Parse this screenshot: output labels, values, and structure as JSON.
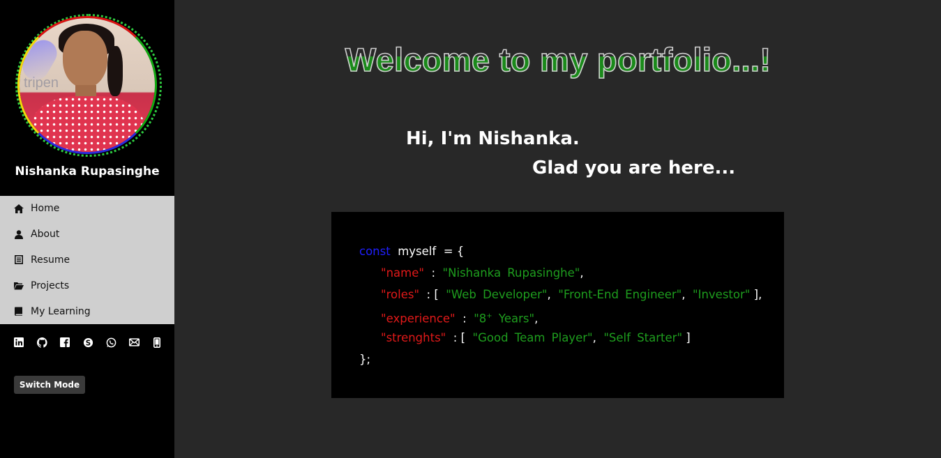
{
  "sidebar": {
    "name": "Nishanka Rupasinghe",
    "avatar_bg_text": "tripen",
    "nav": [
      {
        "label": "Home",
        "icon": "home-icon"
      },
      {
        "label": "About",
        "icon": "user-icon"
      },
      {
        "label": "Resume",
        "icon": "document-icon"
      },
      {
        "label": "Projects",
        "icon": "folder-icon"
      },
      {
        "label": "My Learning",
        "icon": "book-icon"
      }
    ],
    "social": [
      "linkedin-icon",
      "github-icon",
      "facebook-icon",
      "skype-icon",
      "whatsapp-icon",
      "mail-icon",
      "phone-icon"
    ],
    "switch_mode": "Switch Mode"
  },
  "main": {
    "welcome": "Welcome to my portfolio...!",
    "greeting_line1": "Hi, I'm Nishanka.",
    "greeting_line2": "Glad you are here...",
    "code": {
      "const_kw": "const",
      "var_name": "myself",
      "assign": "= {",
      "name_key": "\"name\"",
      "name_val": "\"Nishanka  Rupasinghe\"",
      "roles_key": "\"roles\"",
      "roles_vals": [
        "\"Web  Developer\"",
        "\"Front-End  Engineer\"",
        "\"Investor\""
      ],
      "experience_key": "\"experience\"",
      "experience_val_a": "\"8",
      "experience_val_sup": "+",
      "experience_val_b": "  Years\"",
      "strengths_key": "\"strenghts\"",
      "strengths_vals": [
        "\"Good  Team  Player\"",
        "\"Self  Starter\""
      ],
      "close": "};"
    }
  },
  "colors": {
    "sidebar_bg": "#000000",
    "nav_bg": "#cfcfcf",
    "page_bg": "#282828",
    "code_keyword": "#1f1fff",
    "code_key": "#e11919",
    "code_string": "#1e9e1e"
  }
}
